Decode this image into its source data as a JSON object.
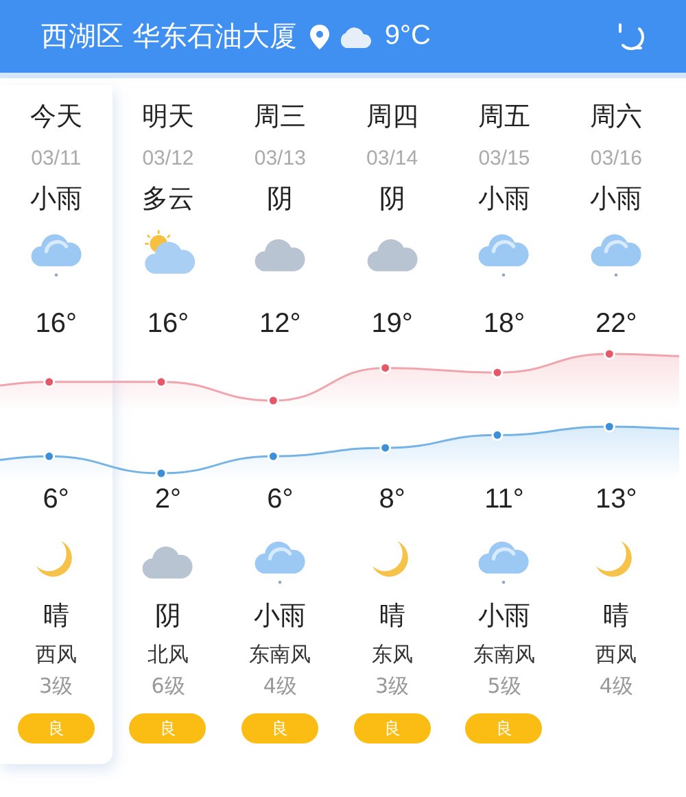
{
  "header": {
    "location": "西湖区 华东石油大厦",
    "temperature": "9°C"
  },
  "days": [
    {
      "name": "今天",
      "date": "03/11",
      "day_condition": "小雨",
      "day_icon": {
        "kind": "rain"
      },
      "high": "16°",
      "low": "6°",
      "night_icon": {
        "kind": "moon"
      },
      "night_condition": "晴",
      "wind": "西风",
      "wind_level": "3级",
      "aqi": "良",
      "selected": true
    },
    {
      "name": "明天",
      "date": "03/12",
      "day_condition": "多云",
      "day_icon": {
        "kind": "partly_cloudy"
      },
      "high": "16°",
      "low": "2°",
      "night_icon": {
        "kind": "overcast"
      },
      "night_condition": "阴",
      "wind": "北风",
      "wind_level": "6级",
      "aqi": "良",
      "selected": false
    },
    {
      "name": "周三",
      "date": "03/13",
      "day_condition": "阴",
      "day_icon": {
        "kind": "overcast"
      },
      "high": "12°",
      "low": "6°",
      "night_icon": {
        "kind": "rain"
      },
      "night_condition": "小雨",
      "wind": "东南风",
      "wind_level": "4级",
      "aqi": "良",
      "selected": false
    },
    {
      "name": "周四",
      "date": "03/14",
      "day_condition": "阴",
      "day_icon": {
        "kind": "overcast"
      },
      "high": "19°",
      "low": "8°",
      "night_icon": {
        "kind": "moon"
      },
      "night_condition": "晴",
      "wind": "东风",
      "wind_level": "3级",
      "aqi": "良",
      "selected": false
    },
    {
      "name": "周五",
      "date": "03/15",
      "day_condition": "小雨",
      "day_icon": {
        "kind": "rain"
      },
      "high": "18°",
      "low": "11°",
      "night_icon": {
        "kind": "rain"
      },
      "night_condition": "小雨",
      "wind": "东南风",
      "wind_level": "5级",
      "aqi": "良",
      "selected": false
    },
    {
      "name": "周六",
      "date": "03/16",
      "day_condition": "小雨",
      "day_icon": {
        "kind": "rain"
      },
      "high": "22°",
      "low": "13°",
      "night_icon": {
        "kind": "moon"
      },
      "night_condition": "晴",
      "wind": "西风",
      "wind_level": "4级",
      "selected": false
    }
  ]
}
